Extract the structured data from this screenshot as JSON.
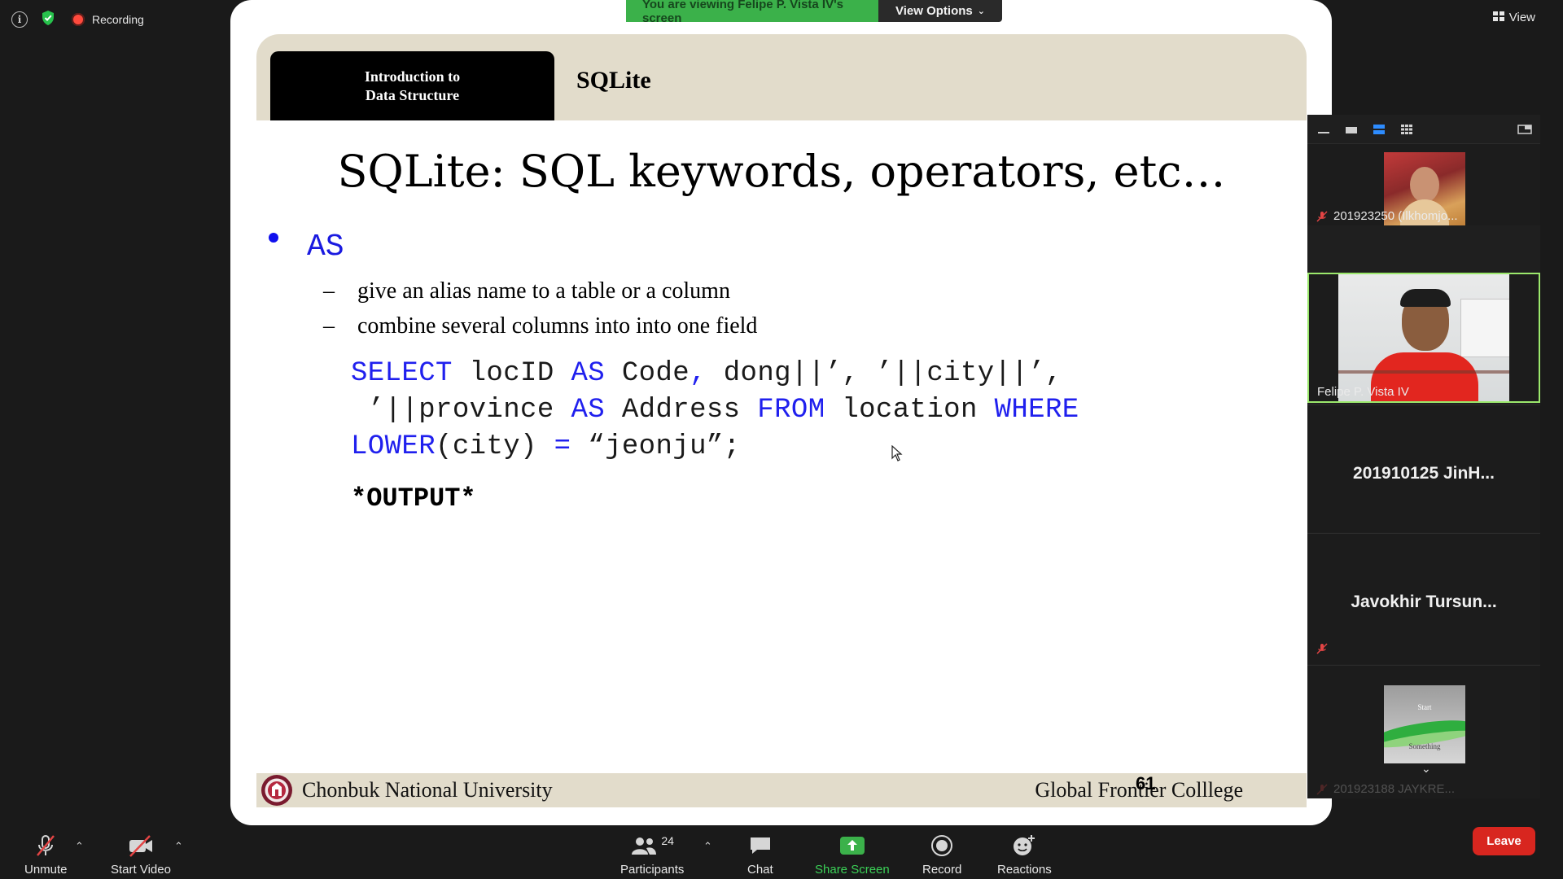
{
  "status": {
    "recording_label": "Recording",
    "view_label": "View"
  },
  "share_banner": {
    "viewing_text": "You are viewing Felipe P. Vista IV's screen",
    "view_options_label": "View Options"
  },
  "slide": {
    "course": [
      "Introduction to",
      "Data Structure"
    ],
    "topic": "SQLite",
    "title": "SQLite: SQL keywords, operators, etc…",
    "bullet_keyword": "AS",
    "sub_bullets": [
      "give an alias name to a table or a column",
      "combine several columns into into one field"
    ],
    "code": {
      "l1_kw1": "SELECT",
      "l1_t1": " locID ",
      "l1_kw2": "AS",
      "l1_t2": " Code",
      "l1_kw3": ",",
      "l1_t3": " dong||’, ’||city||’,",
      "l2_t1": " ’||province ",
      "l2_kw1": "AS",
      "l2_t2": " Address ",
      "l2_kw2": "FROM",
      "l2_t3": " location ",
      "l2_kw3": "WHERE",
      "l3_kw1": "LOWER",
      "l3_t1": "(city) ",
      "l3_kw2": "=",
      "l3_t2": " “jeonju”;"
    },
    "output_label": "*OUTPUT*",
    "footer_university": "Chonbuk  National University",
    "footer_college": "Global Frontier Colllege",
    "page_number": "61"
  },
  "participants_panel": {
    "tiles": [
      {
        "name": "201923250 (Ilkhomjo...",
        "muted": true
      },
      {
        "name": "Felipe P. Vista IV",
        "muted": false
      },
      {
        "name": "201910125  JinH...",
        "muted": false
      },
      {
        "name": "Javokhir  Tursun...",
        "muted": true
      },
      {
        "name": "201923188 JAYKRE...",
        "muted": true
      }
    ],
    "thumb_text": [
      "Start",
      "Something"
    ]
  },
  "toolbar": {
    "unmute": "Unmute",
    "start_video": "Start Video",
    "participants": "Participants",
    "participant_count": "24",
    "chat": "Chat",
    "share_screen": "Share Screen",
    "record": "Record",
    "reactions": "Reactions",
    "leave": "Leave"
  },
  "colors": {
    "accent_green": "#3bb14a",
    "leave_red": "#d8261f",
    "keyword_blue": "#2020ee",
    "slide_band": "#e2dccb"
  }
}
